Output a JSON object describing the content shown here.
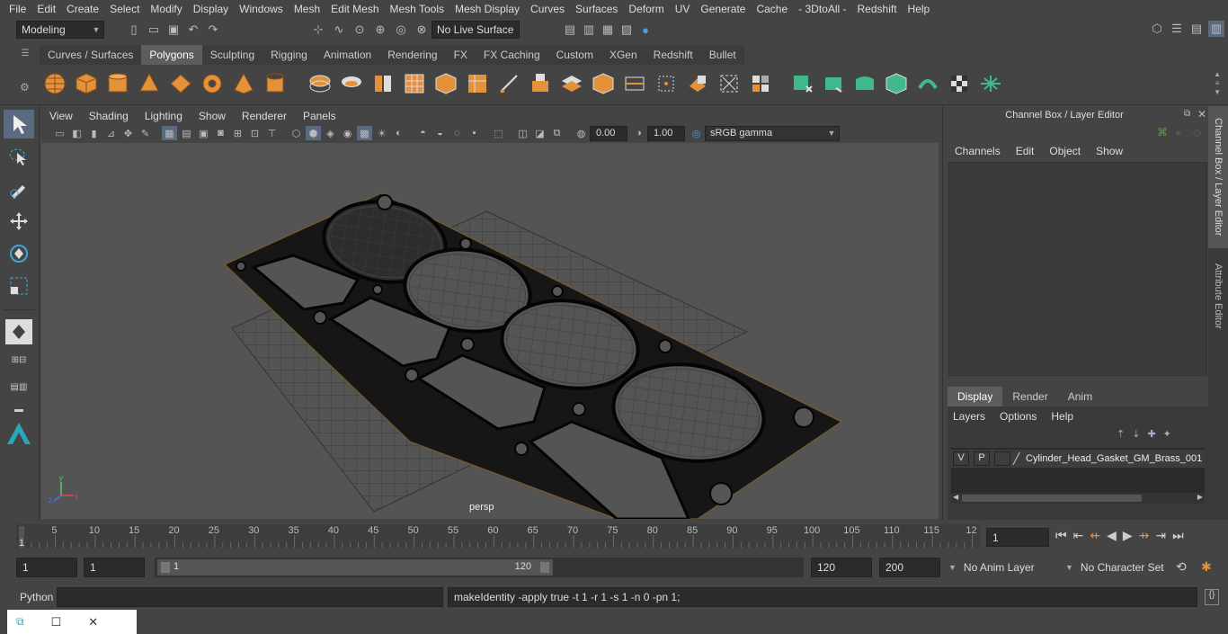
{
  "menubar": {
    "items": [
      "File",
      "Edit",
      "Create",
      "Select",
      "Modify",
      "Display",
      "Windows",
      "Mesh",
      "Edit Mesh",
      "Mesh Tools",
      "Mesh Display",
      "Curves",
      "Surfaces",
      "Deform",
      "UV",
      "Generate",
      "Cache",
      "- 3DtoAll -",
      "Redshift",
      "Help"
    ]
  },
  "status": {
    "workspace": "Modeling",
    "live_surface": "No Live Surface"
  },
  "shelf": {
    "tabs": [
      "Curves / Surfaces",
      "Polygons",
      "Sculpting",
      "Rigging",
      "Animation",
      "Rendering",
      "FX",
      "FX Caching",
      "Custom",
      "XGen",
      "Redshift",
      "Bullet"
    ],
    "active_tab": "Polygons"
  },
  "panel": {
    "menus": [
      "View",
      "Shading",
      "Lighting",
      "Show",
      "Renderer",
      "Panels"
    ],
    "exposure": "0.00",
    "gamma": "1.00",
    "colorspace": "sRGB gamma",
    "camera_label": "persp"
  },
  "channel_box": {
    "title": "Channel Box / Layer Editor",
    "menus": [
      "Channels",
      "Edit",
      "Object",
      "Show"
    ],
    "layer_tabs": [
      "Display",
      "Render",
      "Anim"
    ],
    "active_layer_tab": "Display",
    "layer_menus": [
      "Layers",
      "Options",
      "Help"
    ],
    "layer": {
      "v": "V",
      "p": "P",
      "name": "Cylinder_Head_Gasket_GM_Brass_001"
    }
  },
  "side_tabs": {
    "channel": "Channel Box / Layer Editor",
    "attribute": "Attribute Editor"
  },
  "timeline": {
    "ticks": [
      "5",
      "10",
      "15",
      "20",
      "25",
      "30",
      "35",
      "40",
      "45",
      "50",
      "55",
      "60",
      "65",
      "70",
      "75",
      "80",
      "85",
      "90",
      "95",
      "100",
      "105",
      "110",
      "115",
      "12"
    ],
    "start_label": "1",
    "current_frame": "1"
  },
  "range": {
    "start": "1",
    "playback_start": "1",
    "slider_start": "1",
    "slider_end": "120",
    "playback_end": "120",
    "end": "200",
    "anim_layer": "No Anim Layer",
    "character_set": "No Character Set"
  },
  "cmd": {
    "language": "Python",
    "result": "makeIdentity -apply true -t 1 -r 1 -s 1 -n 0 -pn 1;"
  },
  "colors": {
    "accent_orange": "#e3913a",
    "accent_green": "#3fb88a",
    "active_tab": "#5d5d5d",
    "select_blue": "#5a6a80"
  }
}
